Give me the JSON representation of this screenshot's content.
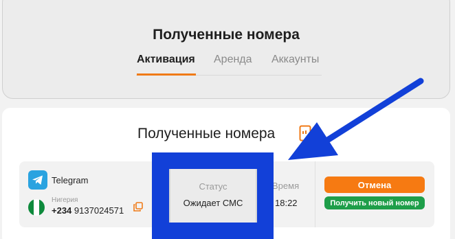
{
  "header": {
    "title": "Полученные номера",
    "tabs": [
      {
        "label": "Активация",
        "active": true
      },
      {
        "label": "Аренда",
        "active": false
      },
      {
        "label": "Аккаунты",
        "active": false
      }
    ]
  },
  "main": {
    "title": "Полученные номера"
  },
  "number_row": {
    "service": "Telegram",
    "country": "Нигерия",
    "phone_code": "+234",
    "phone_number": "9137024571",
    "status_label": "Статус",
    "status_value": "Ожидает СМС",
    "time_label": "Время",
    "time_value": "18:22",
    "cancel_label": "Отмена",
    "new_number_label": "Получить новый номер"
  },
  "icons": {
    "service": "telegram-icon",
    "flag": "nigeria-flag-icon",
    "copy": "copy-icon",
    "document": "document-icon"
  },
  "colors": {
    "accent": "#f07a16",
    "cancel_button": "#f67a12",
    "new_number_button": "#1e9e49",
    "annotation": "#1240d8"
  }
}
